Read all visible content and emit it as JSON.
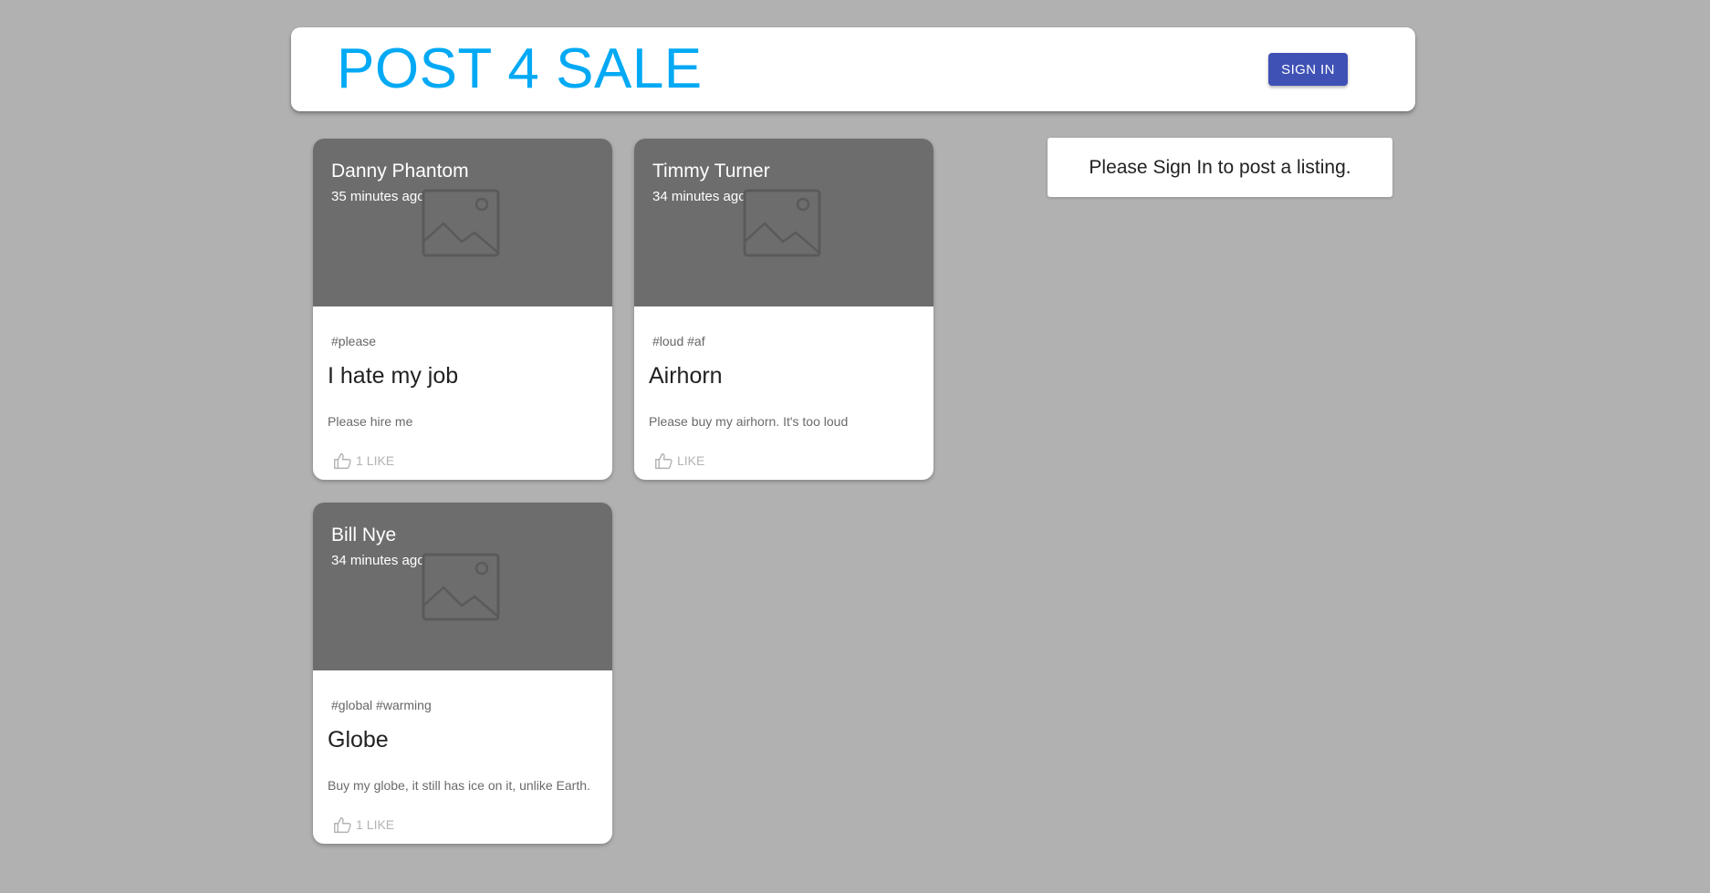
{
  "header": {
    "brand": "POST 4 SALE",
    "sign_in_label": "SIGN IN"
  },
  "posts": [
    {
      "author": "Danny Phantom",
      "time": "35 minutes ago",
      "tags": "#please",
      "title": "I hate my job",
      "description": "Please hire me",
      "like_count": "1",
      "like_label": "LIKE"
    },
    {
      "author": "Timmy Turner",
      "time": "34 minutes ago",
      "tags": "#loud #af",
      "title": "Airhorn",
      "description": "Please buy my airhorn. It's too loud",
      "like_count": "",
      "like_label": "LIKE"
    },
    {
      "author": "Bill Nye",
      "time": "34 minutes ago",
      "tags": "#global #warming",
      "title": "Globe",
      "description": "Buy my globe, it still has ice on it, unlike Earth.",
      "like_count": "1",
      "like_label": "LIKE"
    }
  ],
  "sidebar": {
    "notice": "Please Sign In to post a listing."
  },
  "colors": {
    "brand": "#03a9f4",
    "primary_button": "#3f51b5",
    "background": "#b1b1b1",
    "card_media": "#6d6d6d"
  },
  "icons": {
    "image_placeholder": "image-icon",
    "like": "thumb-up-icon"
  }
}
